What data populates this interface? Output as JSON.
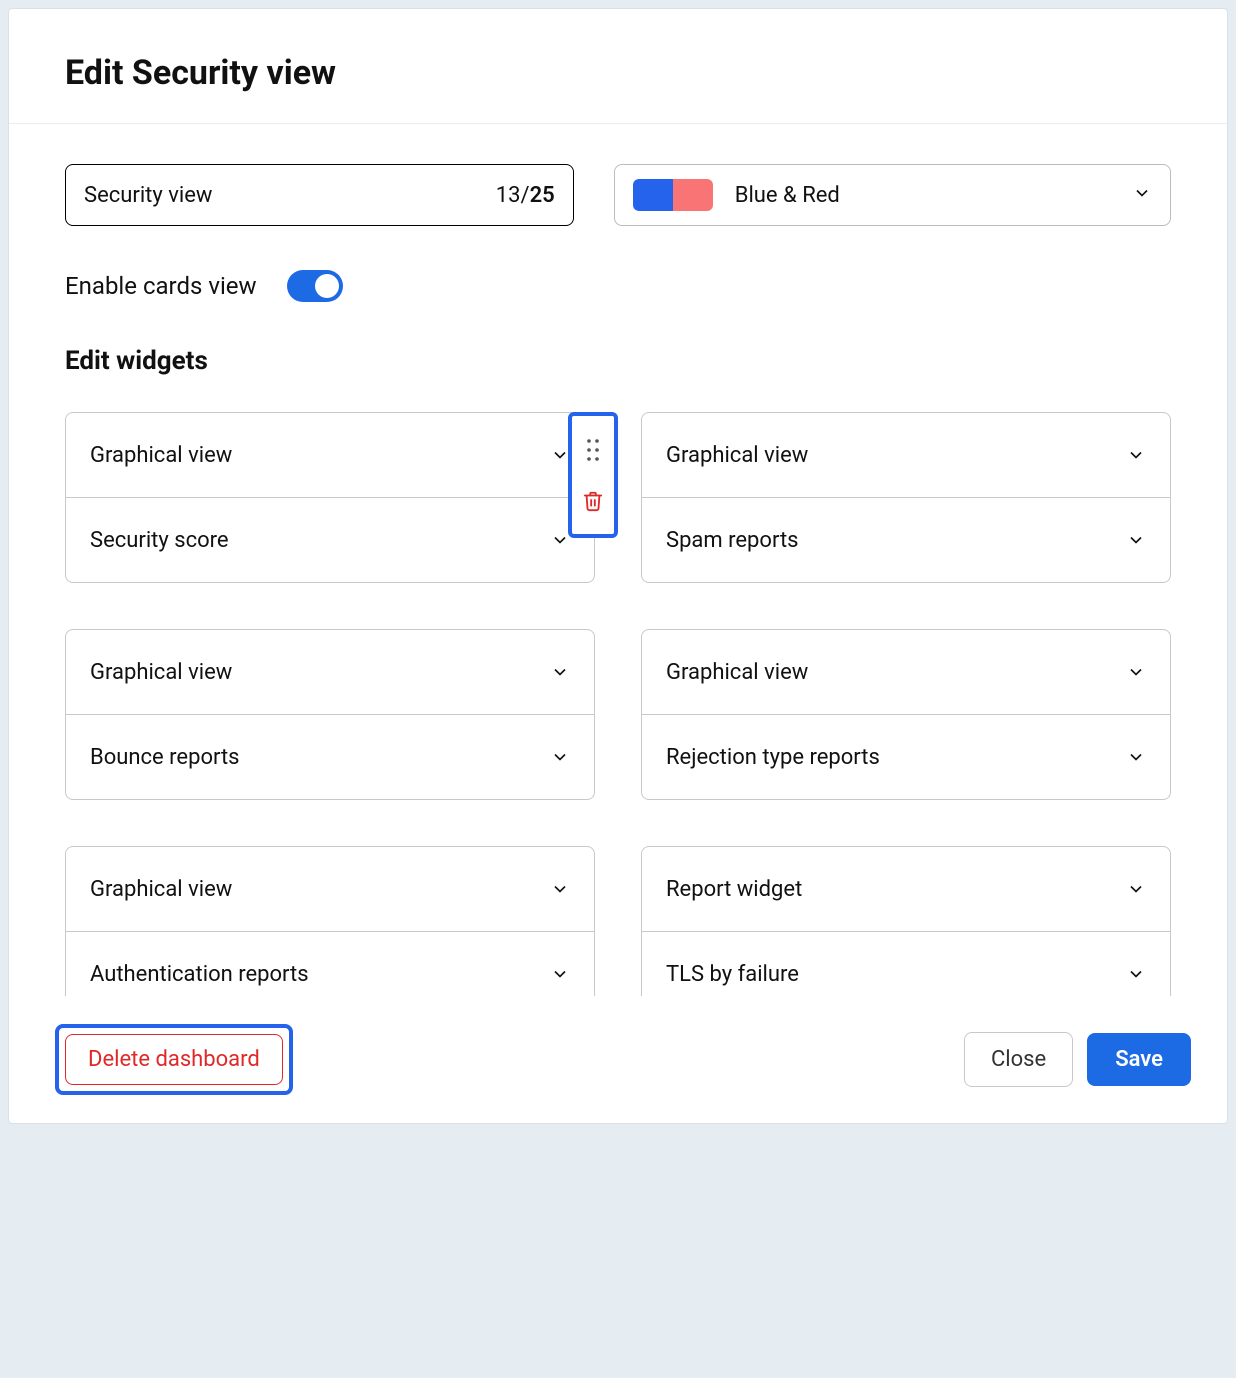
{
  "dialog_title": "Edit Security view",
  "name_input": {
    "value": "Security view",
    "count": "13",
    "max": "25"
  },
  "color_picker": {
    "label": "Blue & Red",
    "swatch": [
      "#2563ed",
      "#f97474"
    ]
  },
  "cards_toggle": {
    "label": "Enable cards view",
    "on": true
  },
  "widgets_heading": "Edit widgets",
  "widgets": [
    [
      {
        "type": "Graphical view",
        "source": "Security score"
      },
      {
        "type": "Graphical view",
        "source": "Spam reports"
      }
    ],
    [
      {
        "type": "Graphical view",
        "source": "Bounce reports"
      },
      {
        "type": "Graphical view",
        "source": "Rejection type reports"
      }
    ],
    [
      {
        "type": "Graphical view",
        "source": "Authentication reports"
      },
      {
        "type": "Report widget",
        "source": "TLS by failure"
      }
    ]
  ],
  "footer": {
    "delete": "Delete dashboard",
    "close": "Close",
    "save": "Save"
  }
}
